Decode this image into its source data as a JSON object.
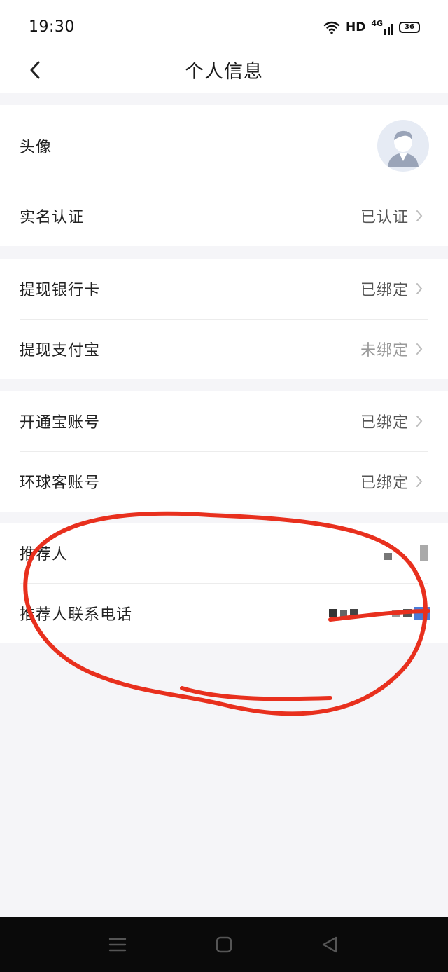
{
  "status_bar": {
    "time": "19:30",
    "hd_label": "HD",
    "network_label": "4G",
    "battery_level": "36"
  },
  "nav": {
    "title": "个人信息"
  },
  "profile": {
    "avatar_label": "头像",
    "real_name_label": "实名认证",
    "real_name_value": "已认证"
  },
  "withdraw": {
    "bank_card_label": "提现银行卡",
    "bank_card_value": "已绑定",
    "alipay_label": "提现支付宝",
    "alipay_value": "未绑定"
  },
  "accounts": {
    "kaitongbao_label": "开通宝账号",
    "kaitongbao_value": "已绑定",
    "huanqiuke_label": "环球客账号",
    "huanqiuke_value": "已绑定"
  },
  "referrer": {
    "name_label": "推荐人",
    "phone_label": "推荐人联系电话"
  },
  "colors": {
    "background": "#f5f5f8",
    "card": "#ffffff",
    "annotation_red": "#e8301e",
    "muted_text": "#999999"
  }
}
